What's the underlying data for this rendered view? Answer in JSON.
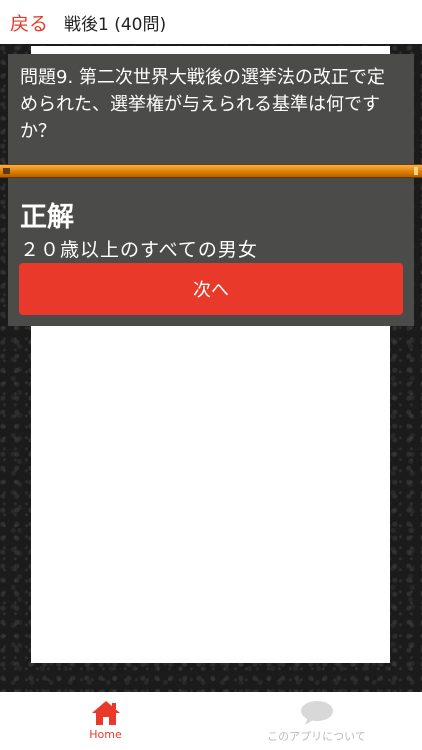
{
  "header": {
    "back_label": "戻る",
    "title": "戦後1 (40問)"
  },
  "question": {
    "text": "問題9. 第二次世界大戦後の選挙法の改正で定められた、選挙権が与えられる基準は何ですか？"
  },
  "answer": {
    "title": "正解",
    "text": "２０歳以上のすべての男女",
    "next_label": "次へ"
  },
  "tabs": [
    {
      "label": "Home",
      "icon": "home-icon",
      "active": true
    },
    {
      "label": "このアプリについて",
      "icon": "speech-bubble-icon",
      "active": false
    }
  ],
  "colors": {
    "accent": "#e8392a",
    "panel": "#4b4b49",
    "progress": "#e07f00",
    "inactive_tab": "#bcbcbc"
  }
}
